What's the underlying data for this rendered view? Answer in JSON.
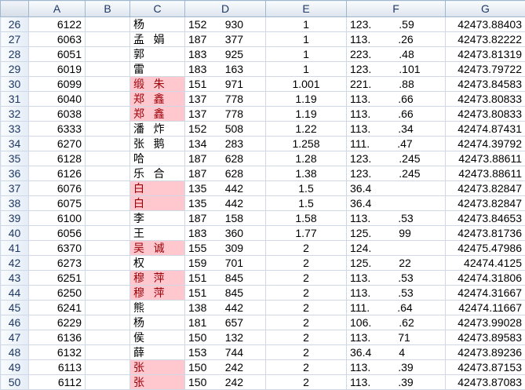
{
  "columns": [
    "A",
    "B",
    "C",
    "D",
    "E",
    "F",
    "G"
  ],
  "rows": [
    {
      "row": "26",
      "a": "6122",
      "c1": "杨",
      "c2": "",
      "d1": "152",
      "d2": "930",
      "e": "1",
      "f1": "123.",
      "f2": ".59",
      "g": "42473.88403",
      "hl": false
    },
    {
      "row": "27",
      "a": "6063",
      "c1": "孟",
      "c2": "娟",
      "d1": "187",
      "d2": "377",
      "e": "1",
      "f1": "113.",
      "f2": ".26",
      "g": "42473.82222",
      "hl": false
    },
    {
      "row": "28",
      "a": "6051",
      "c1": "郭",
      "c2": "",
      "d1": "183",
      "d2": "925",
      "e": "1",
      "f1": "223.",
      "f2": ".48",
      "g": "42473.81319",
      "hl": false
    },
    {
      "row": "29",
      "a": "6019",
      "c1": "雷",
      "c2": "",
      "d1": "183",
      "d2": "163",
      "e": "1",
      "f1": "123.",
      "f2": ".101",
      "g": "42473.79722",
      "hl": false
    },
    {
      "row": "30",
      "a": "6099",
      "c1": "缎",
      "c2": "朱",
      "d1": "151",
      "d2": "971",
      "e": "1.001",
      "f1": "221.",
      "f2": ".88",
      "g": "42473.84583",
      "hl": true
    },
    {
      "row": "31",
      "a": "6040",
      "c1": "郑",
      "c2": "鑫",
      "d1": "137",
      "d2": "778",
      "e": "1.19",
      "f1": "113.",
      "f2": ".66",
      "g": "42473.80833",
      "hl": true
    },
    {
      "row": "32",
      "a": "6038",
      "c1": "郑",
      "c2": "鑫",
      "d1": "137",
      "d2": "778",
      "e": "1.19",
      "f1": "113.",
      "f2": ".66",
      "g": "42473.80833",
      "hl": true
    },
    {
      "row": "33",
      "a": "6333",
      "c1": "潘",
      "c2": "炸",
      "d1": "152",
      "d2": "508",
      "e": "1.22",
      "f1": "113.",
      "f2": ".34",
      "g": "42474.87431",
      "hl": false
    },
    {
      "row": "34",
      "a": "6270",
      "c1": "张",
      "c2": "鹅",
      "d1": "134",
      "d2": "283",
      "e": "1.258",
      "f1": "111.",
      "f2": ".47",
      "g": "42474.39792",
      "hl": false
    },
    {
      "row": "35",
      "a": "6128",
      "c1": "哈",
      "c2": "",
      "d1": "187",
      "d2": "628",
      "e": "1.28",
      "f1": "123.",
      "f2": ".245",
      "g": "42473.88611",
      "hl": false
    },
    {
      "row": "36",
      "a": "6126",
      "c1": "乐",
      "c2": "合",
      "d1": "187",
      "d2": "628",
      "e": "1.38",
      "f1": "123.",
      "f2": ".245",
      "g": "42473.88611",
      "hl": false
    },
    {
      "row": "37",
      "a": "6076",
      "c1": "白",
      "c2": "",
      "d1": "135",
      "d2": "442",
      "e": "1.5",
      "f1": "36.4",
      "f2": "",
      "g": "42473.82847",
      "hl": true
    },
    {
      "row": "38",
      "a": "6075",
      "c1": "白",
      "c2": "",
      "d1": "135",
      "d2": "442",
      "e": "1.5",
      "f1": "36.4",
      "f2": "",
      "g": "42473.82847",
      "hl": true
    },
    {
      "row": "39",
      "a": "6100",
      "c1": "李",
      "c2": "",
      "d1": "187",
      "d2": "158",
      "e": "1.58",
      "f1": "113.",
      "f2": ".53",
      "g": "42473.84653",
      "hl": false
    },
    {
      "row": "40",
      "a": "6056",
      "c1": "王",
      "c2": "",
      "d1": "183",
      "d2": "360",
      "e": "1.77",
      "f1": "125.",
      "f2": "99",
      "g": "42473.81736",
      "hl": false
    },
    {
      "row": "41",
      "a": "6370",
      "c1": "吴",
      "c2": "诚",
      "d1": "155",
      "d2": "309",
      "e": "2",
      "f1": "124.",
      "f2": "",
      "g": "42475.47986",
      "hl": true
    },
    {
      "row": "42",
      "a": "6273",
      "c1": "权",
      "c2": "",
      "d1": "159",
      "d2": "701",
      "e": "2",
      "f1": "125.",
      "f2": "22",
      "g": "42474.4125",
      "hl": false
    },
    {
      "row": "43",
      "a": "6251",
      "c1": "穆",
      "c2": "萍",
      "d1": "151",
      "d2": "845",
      "e": "2",
      "f1": "113.",
      "f2": ".53",
      "g": "42474.31806",
      "hl": true
    },
    {
      "row": "44",
      "a": "6250",
      "c1": "穆",
      "c2": "萍",
      "d1": "151",
      "d2": "845",
      "e": "2",
      "f1": "113.",
      "f2": ".53",
      "g": "42474.31667",
      "hl": true
    },
    {
      "row": "45",
      "a": "6241",
      "c1": "熊",
      "c2": "",
      "d1": "138",
      "d2": "442",
      "e": "2",
      "f1": "111.",
      "f2": ".64",
      "g": "42474.11667",
      "hl": false
    },
    {
      "row": "46",
      "a": "6229",
      "c1": "杨",
      "c2": "",
      "d1": "181",
      "d2": "657",
      "e": "2",
      "f1": "106.",
      "f2": ".62",
      "g": "42473.99028",
      "hl": false
    },
    {
      "row": "47",
      "a": "6136",
      "c1": "侯",
      "c2": "",
      "d1": "150",
      "d2": "132",
      "e": "2",
      "f1": "113.",
      "f2": "71",
      "g": "42473.89583",
      "hl": false
    },
    {
      "row": "48",
      "a": "6132",
      "c1": "薛",
      "c2": "",
      "d1": "153",
      "d2": "744",
      "e": "2",
      "f1": "36.4",
      "f2": "4",
      "g": "42473.89236",
      "hl": false
    },
    {
      "row": "49",
      "a": "6113",
      "c1": "张",
      "c2": "",
      "d1": "150",
      "d2": "242",
      "e": "2",
      "f1": "113.",
      "f2": ".39",
      "g": "42473.87153",
      "hl": true
    },
    {
      "row": "50",
      "a": "6112",
      "c1": "张",
      "c2": "",
      "d1": "150",
      "d2": "242",
      "e": "2",
      "f1": "113.",
      "f2": ".39",
      "g": "42473.87083",
      "hl": true
    }
  ],
  "colors": {
    "highlight_fill": "#ffc7ce",
    "highlight_text": "#9c0006",
    "header_text": "#1f3864",
    "gridline": "#d0d7e5"
  }
}
